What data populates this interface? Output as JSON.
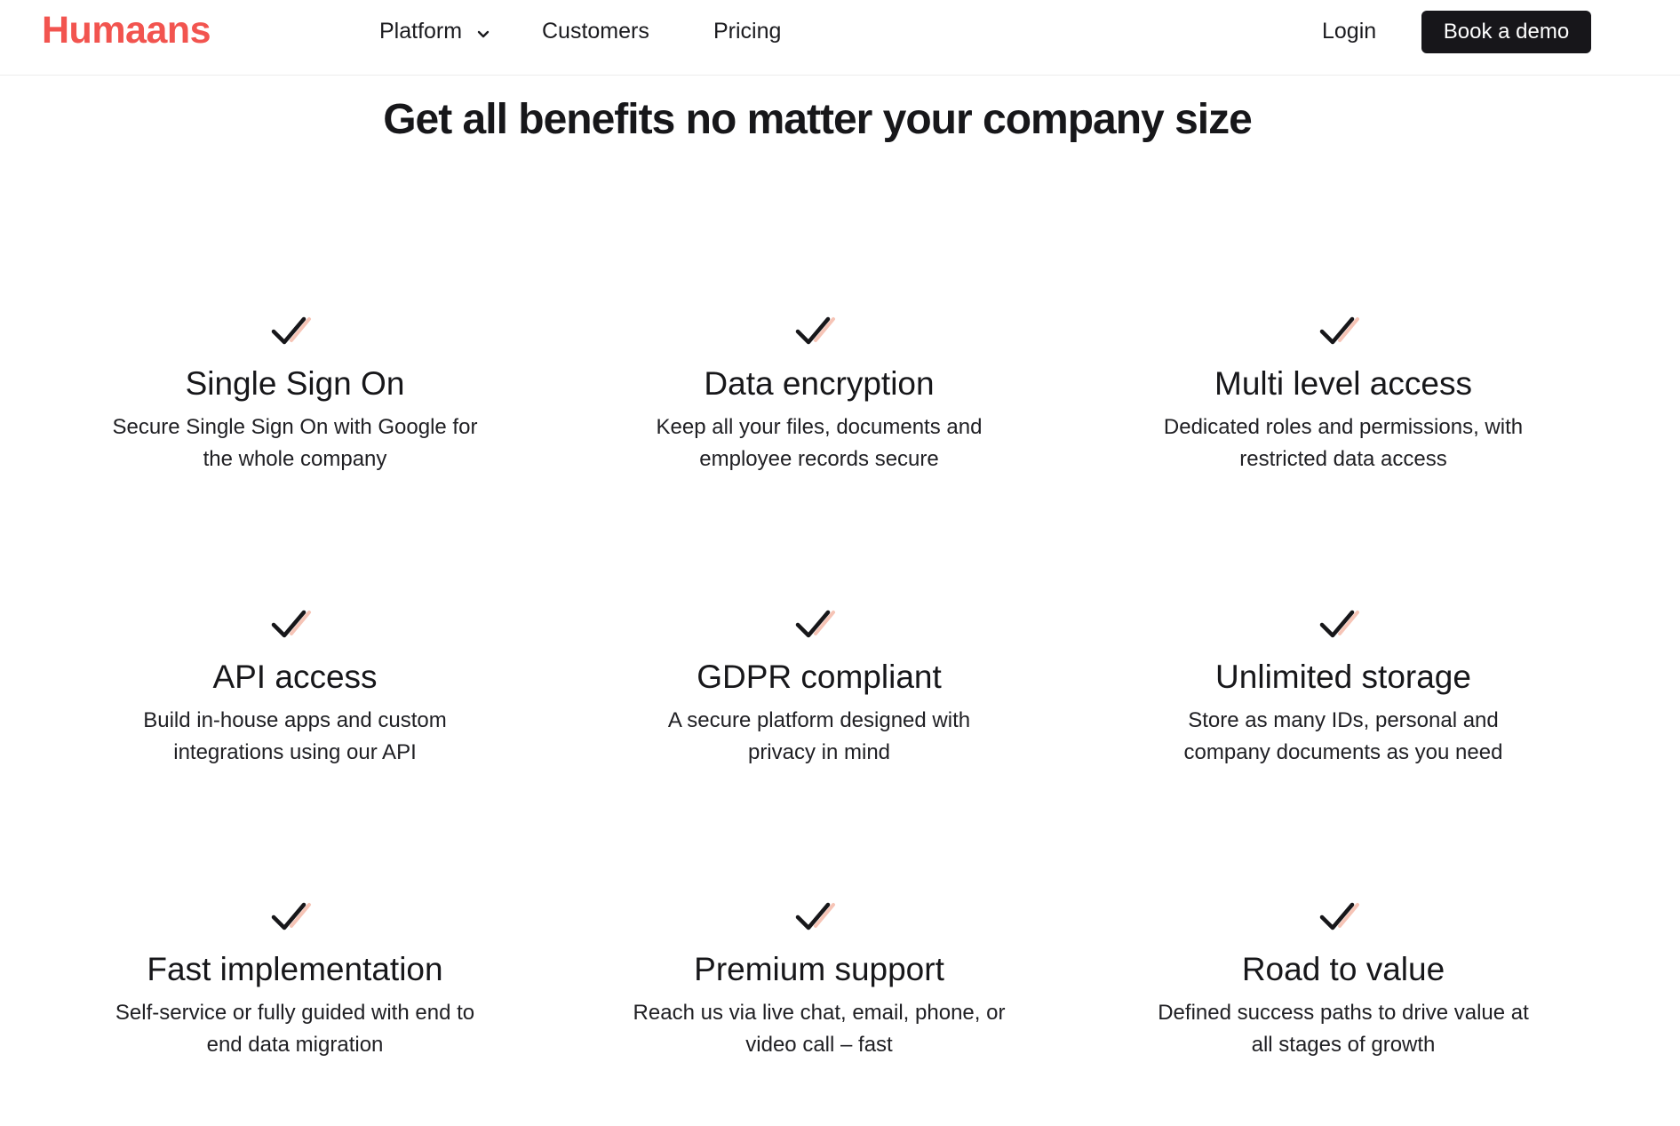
{
  "header": {
    "logo": "Humaans",
    "nav": {
      "platform": "Platform",
      "customers": "Customers",
      "pricing": "Pricing"
    },
    "login": "Login",
    "cta": "Book a demo"
  },
  "main": {
    "headline": "Get all benefits no matter your company size",
    "features": [
      {
        "title": "Single Sign On",
        "desc": "Secure Single Sign On with Google for the whole company"
      },
      {
        "title": "Data encryption",
        "desc": "Keep all your files, documents and employee records secure"
      },
      {
        "title": "Multi level access",
        "desc": "Dedicated roles and permissions, with restricted data access"
      },
      {
        "title": "API access",
        "desc": "Build in-house apps and custom integrations using our API"
      },
      {
        "title": "GDPR compliant",
        "desc": "A secure platform designed with privacy in mind"
      },
      {
        "title": "Unlimited storage",
        "desc": "Store as many IDs, personal and company documents as you need"
      },
      {
        "title": "Fast implementation",
        "desc": "Self-service or fully guided with end to end data migration"
      },
      {
        "title": "Premium support",
        "desc": "Reach us via live chat, email, phone, or video call – fast"
      },
      {
        "title": "Road to value",
        "desc": "Defined success paths to drive value at all stages of growth"
      }
    ]
  },
  "colors": {
    "brand": "#f2544f",
    "check_dark": "#17171a",
    "check_accent": "#f6c4b6",
    "button_bg": "#17161a"
  },
  "icons": {
    "feature": "checkmark-icon",
    "dropdown": "chevron-down-icon"
  }
}
